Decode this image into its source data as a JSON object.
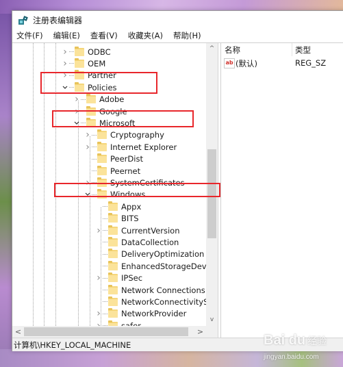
{
  "window": {
    "title": "注册表编辑器",
    "app_icon": "regedit-icon"
  },
  "menubar": {
    "items": [
      {
        "label": "文件(F)"
      },
      {
        "label": "编辑(E)"
      },
      {
        "label": "查看(V)"
      },
      {
        "label": "收藏夹(A)"
      },
      {
        "label": "帮助(H)"
      }
    ]
  },
  "tree": {
    "nodes": [
      {
        "label": "ODBC",
        "level": 0,
        "expander": "collapsed"
      },
      {
        "label": "OEM",
        "level": 0,
        "expander": "collapsed"
      },
      {
        "label": "Partner",
        "level": 0,
        "expander": "collapsed"
      },
      {
        "label": "Policies",
        "level": 0,
        "expander": "expanded"
      },
      {
        "label": "Adobe",
        "level": 1,
        "expander": "collapsed"
      },
      {
        "label": "Google",
        "level": 1,
        "expander": "collapsed"
      },
      {
        "label": "Microsoft",
        "level": 1,
        "expander": "expanded"
      },
      {
        "label": "Cryptography",
        "level": 2,
        "expander": "collapsed"
      },
      {
        "label": "Internet Explorer",
        "level": 2,
        "expander": "collapsed"
      },
      {
        "label": "PeerDist",
        "level": 2,
        "expander": "none"
      },
      {
        "label": "Peernet",
        "level": 2,
        "expander": "none"
      },
      {
        "label": "SystemCertificates",
        "level": 2,
        "expander": "collapsed"
      },
      {
        "label": "Windows",
        "level": 2,
        "expander": "expanded"
      },
      {
        "label": "Appx",
        "level": 3,
        "expander": "none"
      },
      {
        "label": "BITS",
        "level": 3,
        "expander": "none"
      },
      {
        "label": "CurrentVersion",
        "level": 3,
        "expander": "collapsed"
      },
      {
        "label": "DataCollection",
        "level": 3,
        "expander": "none"
      },
      {
        "label": "DeliveryOptimization",
        "level": 3,
        "expander": "none"
      },
      {
        "label": "EnhancedStorageDevices",
        "level": 3,
        "expander": "none"
      },
      {
        "label": "IPSec",
        "level": 3,
        "expander": "collapsed"
      },
      {
        "label": "Network Connections",
        "level": 3,
        "expander": "none"
      },
      {
        "label": "NetworkConnectivityStatusIn",
        "level": 3,
        "expander": "none"
      },
      {
        "label": "NetworkProvider",
        "level": 3,
        "expander": "collapsed"
      },
      {
        "label": "safer",
        "level": 3,
        "expander": "collapsed"
      }
    ],
    "highlighted": [
      "Policies",
      "Microsoft",
      "Windows"
    ]
  },
  "values_pane": {
    "columns": {
      "name": "名称",
      "type": "类型"
    },
    "rows": [
      {
        "name": "(默认)",
        "type": "REG_SZ",
        "icon": "string-value-icon",
        "icon_text": "ab"
      }
    ]
  },
  "statusbar": {
    "path": "计算机\\HKEY_LOCAL_MACHINE"
  },
  "scroll": {
    "up": "^",
    "down": "v",
    "left": "<",
    "right": ">"
  },
  "watermark": {
    "logo": "Bai du",
    "cn": "经验",
    "url": "jingyan.baidu.com"
  },
  "colors": {
    "highlight_box": "#e8262b",
    "folder": "#f5d67a"
  }
}
